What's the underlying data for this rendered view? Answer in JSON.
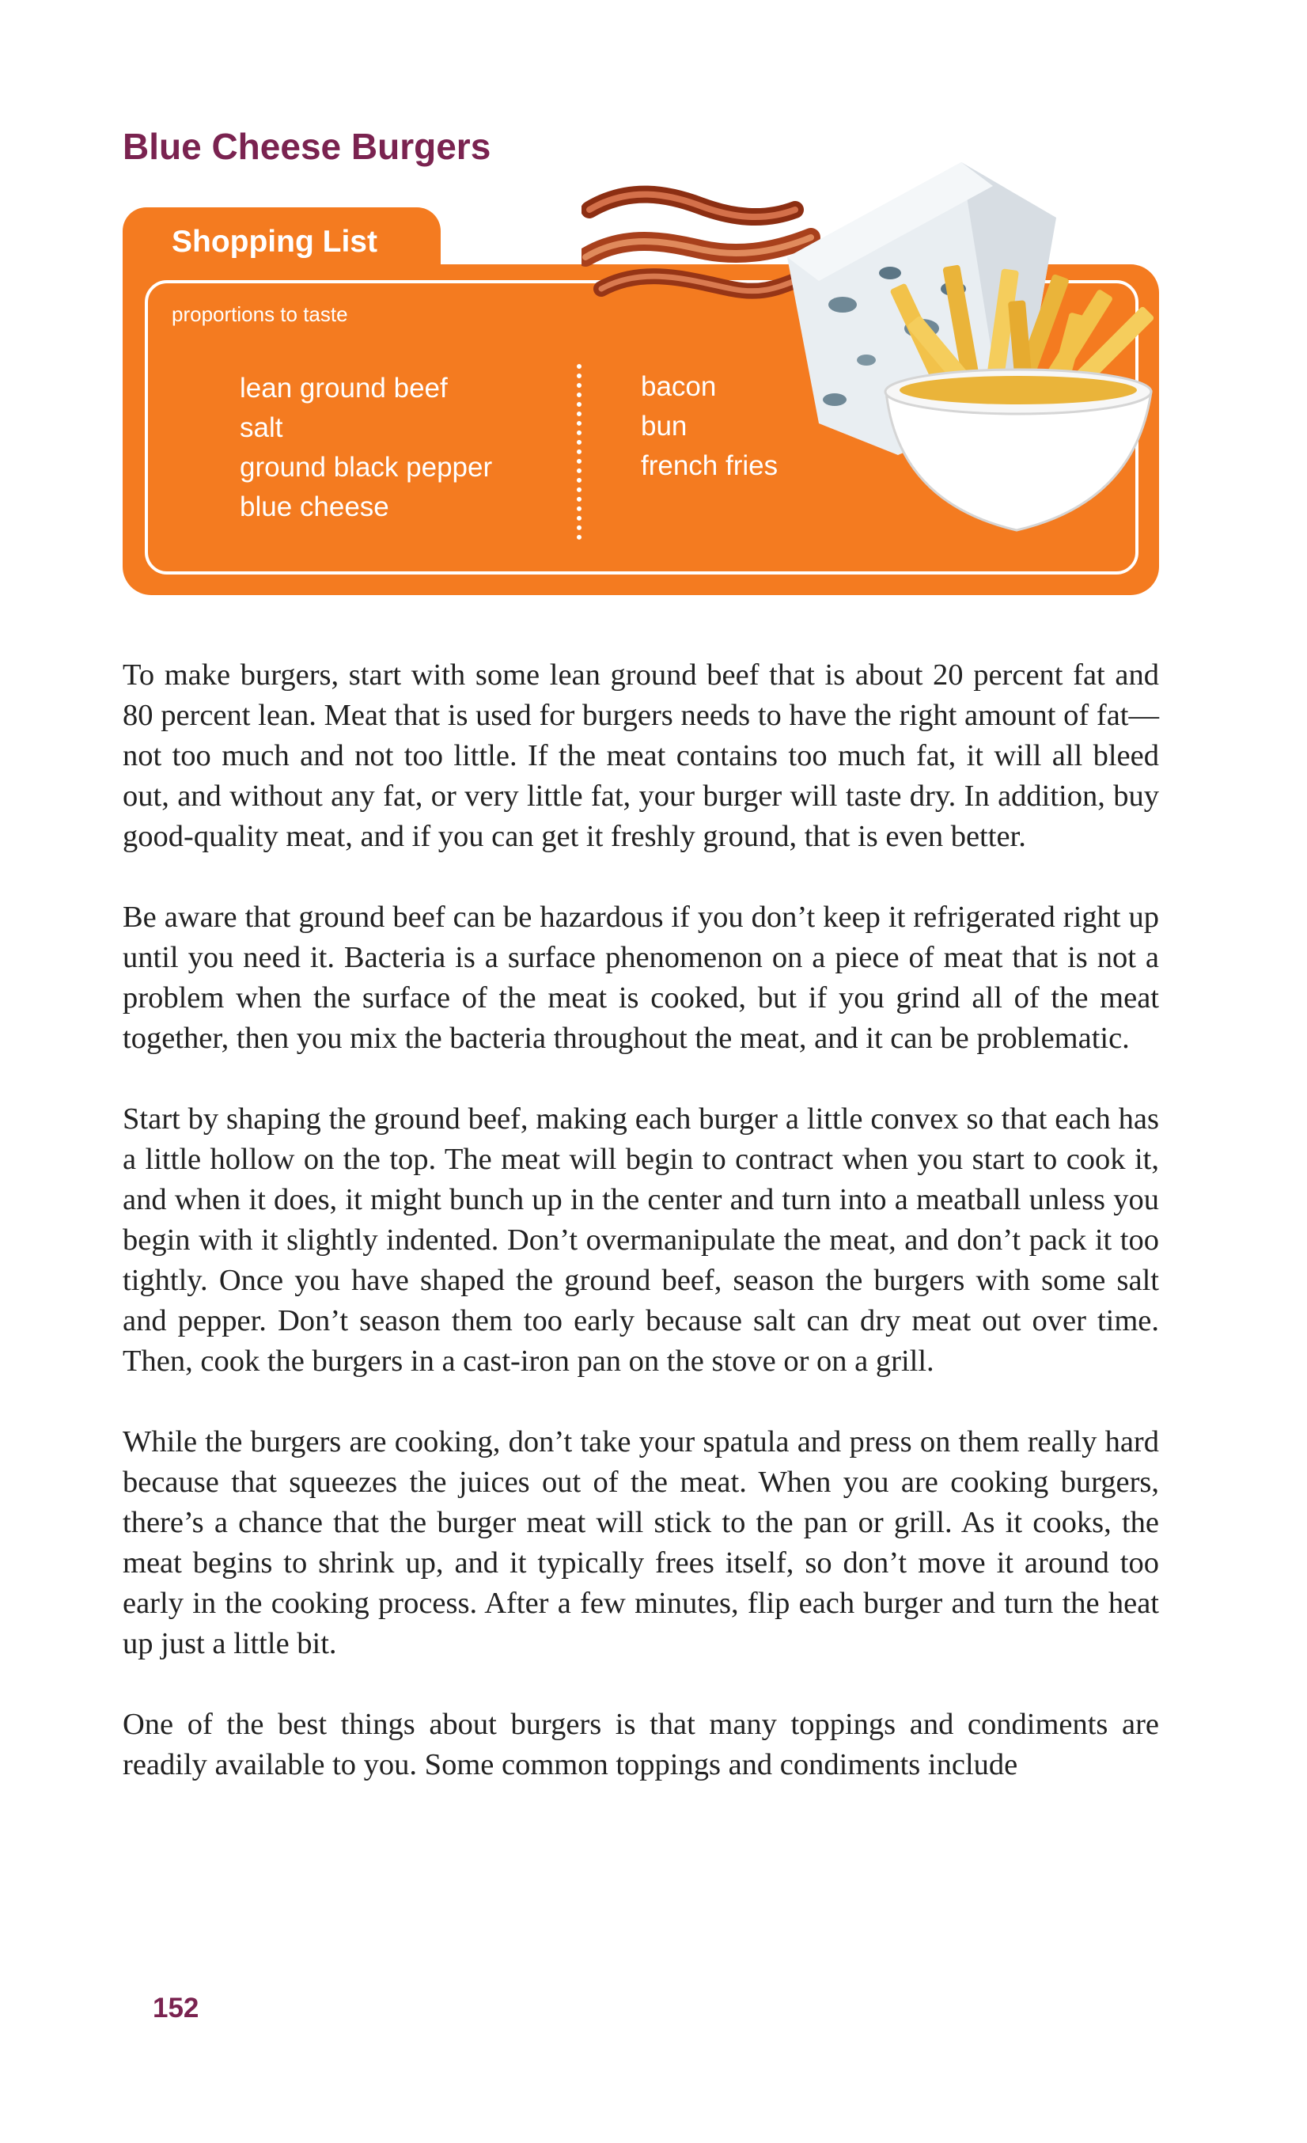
{
  "title": "Blue Cheese Burgers",
  "shopping_list": {
    "tab_label": "Shopping List",
    "subtitle": "proportions to taste",
    "column_1": [
      "lean ground beef",
      "salt",
      "ground black pepper",
      "blue cheese"
    ],
    "column_2": [
      "bacon",
      "bun",
      "french fries"
    ]
  },
  "illustration": {
    "items": [
      "bacon-icon",
      "blue-cheese-icon",
      "french-fries-icon"
    ],
    "colors": {
      "box": "#f47b20",
      "title": "#7a2350",
      "bacon": "#b8461c",
      "cheese": "#e8ecf0",
      "fries": "#f2c24a"
    }
  },
  "paragraphs": [
    "To make burgers, start with some lean ground beef that is about 20 percent fat and 80 percent lean. Meat that is used for burgers needs to have the right amount of fat—not too much and not too little. If the meat contains too much fat, it will all bleed out, and without any fat, or very little fat, your burger will taste dry. In addition, buy good-quality meat, and if you can get it freshly ground, that is even better.",
    "Be aware that ground beef can be hazardous if you don’t keep it refrigerated right up until you need it. Bacteria is a surface phenomenon on a piece of meat that is not a problem when the surface of the meat is cooked, but if you grind all of the meat together, then you mix the bacteria throughout the meat, and it can be problematic.",
    "Start by shaping the ground beef, making each burger a little convex so that each has a little hollow on the top. The meat will begin to contract when you start to cook it, and when it does, it might bunch up in the center and turn into a meatball unless you begin with it slightly indented. Don’t overmanipulate the meat, and don’t pack it too tightly. Once you have shaped the ground beef, season the burgers with some salt and pepper. Don’t season them too early because salt can dry meat out over time. Then, cook the burgers in a cast-iron pan on the stove or on a grill.",
    "While the burgers are cooking, don’t take your spatula and press on them really hard because that squeezes the juices out of the meat. When you are cooking burgers, there’s a chance that the burger meat will stick to the pan or grill. As it cooks, the meat begins to shrink up, and it typically frees itself, so don’t move it around too early in the cooking process. After a few minutes, flip each burger and turn the heat up just a little bit.",
    "One of the best things about burgers is that many toppings and condiments are readily available to you. Some common toppings and condiments include"
  ],
  "page_number": "152"
}
